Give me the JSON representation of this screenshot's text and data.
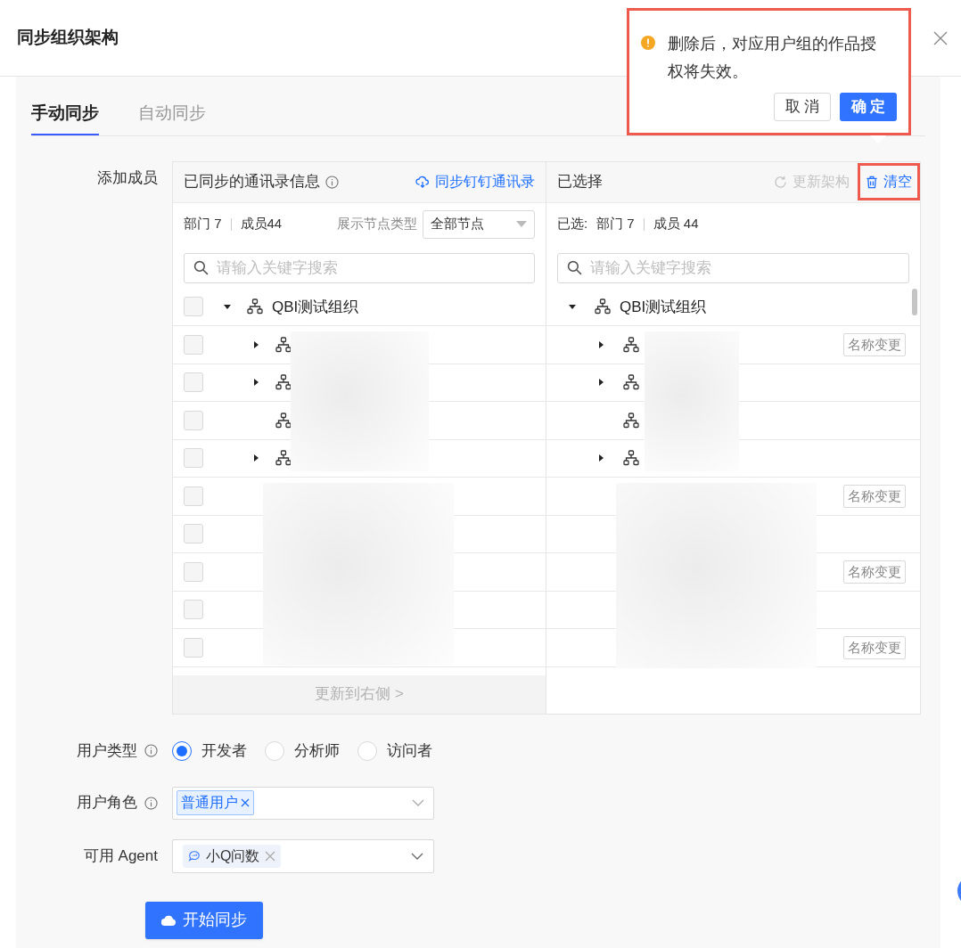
{
  "dialog": {
    "title": "同步组织架构"
  },
  "popconfirm": {
    "message": "删除后，对应用户组的作品授权将失效。",
    "highlighted": true,
    "buttons": [
      {
        "label": "取 消",
        "kind": "default"
      },
      {
        "label": "确 定",
        "kind": "primary"
      }
    ]
  },
  "tabs": [
    {
      "label": "手动同步",
      "selected": true
    },
    {
      "label": "自动同步",
      "selected": false
    }
  ],
  "members": {
    "label": "添加成员",
    "source": {
      "title": "已同步的通讯录信息",
      "action": "同步钉钉通讯录",
      "stats": [
        "部门 7",
        "成员44"
      ],
      "filter": {
        "label": "展示节点类型",
        "value": "全部节点"
      },
      "search": {
        "placeholder": "请输入关键字搜索"
      },
      "root": {
        "label": "QBI测试组织",
        "checked": false,
        "expanded": true
      },
      "rows": [
        {
          "kind": "department",
          "expandable": true,
          "checked": false
        },
        {
          "kind": "department",
          "expandable": true,
          "checked": false
        },
        {
          "kind": "department",
          "expandable": false,
          "checked": false
        },
        {
          "kind": "department",
          "expandable": true,
          "checked": false
        },
        {
          "kind": "member",
          "checked": false
        },
        {
          "kind": "member",
          "checked": false
        },
        {
          "kind": "member",
          "checked": false
        },
        {
          "kind": "member",
          "checked": false
        },
        {
          "kind": "member",
          "checked": false
        }
      ],
      "footer_button": {
        "label": "更新到右侧 >",
        "disabled": true
      }
    },
    "target": {
      "title": "已选择",
      "actions": [
        {
          "label": "更新架构",
          "kind": "refresh",
          "disabled": true,
          "highlighted": false
        },
        {
          "label": "清空",
          "kind": "clear",
          "disabled": false,
          "highlighted": true
        }
      ],
      "stats_label": "已选:",
      "stats": [
        "部门 7",
        "成员 44"
      ],
      "search": {
        "placeholder": "请输入关键字搜索"
      },
      "root": {
        "label": "QBI测试组织",
        "expanded": true
      },
      "rows": [
        {
          "kind": "department",
          "expandable": true,
          "tag": "名称变更"
        },
        {
          "kind": "department",
          "expandable": true
        },
        {
          "kind": "department",
          "expandable": false
        },
        {
          "kind": "department",
          "expandable": true
        },
        {
          "kind": "member",
          "tag": "名称变更"
        },
        {
          "kind": "member"
        },
        {
          "kind": "member",
          "tag": "名称变更"
        },
        {
          "kind": "member"
        },
        {
          "kind": "member",
          "tag": "名称变更"
        }
      ]
    }
  },
  "user_type": {
    "label": "用户类型",
    "options": [
      {
        "label": "开发者",
        "selected": true
      },
      {
        "label": "分析师",
        "selected": false
      },
      {
        "label": "访问者",
        "selected": false
      }
    ]
  },
  "user_role": {
    "label": "用户角色",
    "tags": [
      "普通用户"
    ]
  },
  "agent": {
    "label": "可用 Agent",
    "tags": [
      "小Q问数"
    ]
  },
  "submit": {
    "label": "开始同步"
  }
}
